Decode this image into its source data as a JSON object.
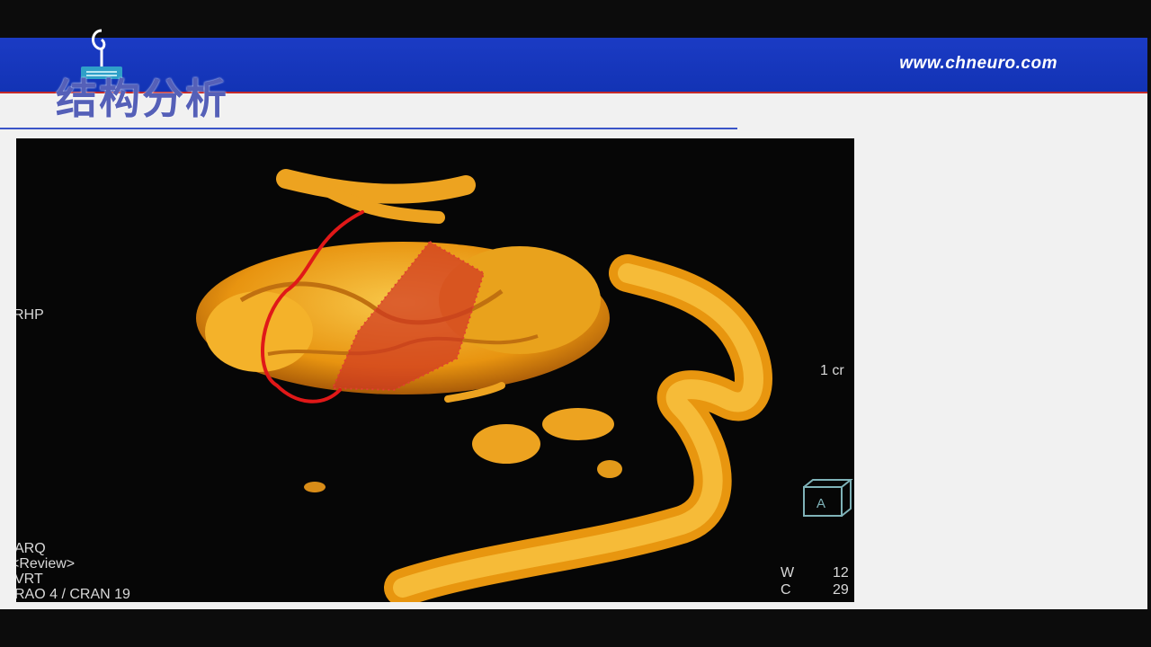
{
  "header": {
    "url": "www.chneuro.com",
    "title": "结构分析",
    "logo_icon": "chneuro-logo-icon",
    "banner_color": "#1435b8",
    "accent_line_color": "#c42a2a"
  },
  "image_viewer": {
    "orientation_left": "RHP",
    "scale_label": "1 cr",
    "bottom_left": {
      "line1": "ARQ",
      "line2": "<Review>",
      "line3": "VRT",
      "line4": "RAO 4 / CRAN 19"
    },
    "window": {
      "w_label": "W",
      "w_value": "12",
      "c_label": "C",
      "c_value": "29"
    },
    "anterior_cube_letter": "A",
    "annotation_colors": {
      "red_outline": "#e01818",
      "dotted_region": "#d63a2a",
      "vessel": "#f2a41a"
    }
  }
}
